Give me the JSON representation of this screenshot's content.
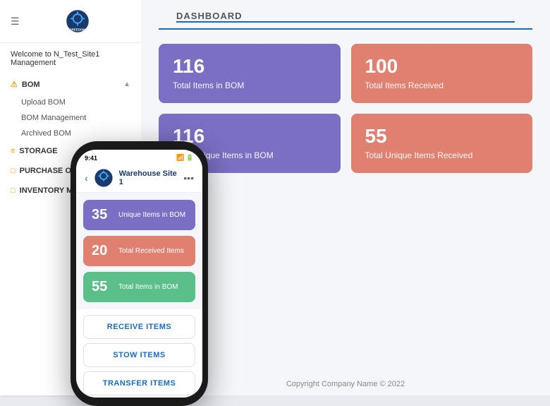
{
  "sidebar": {
    "hamburger": "☰",
    "logo_alt": "Freedom Robotics",
    "welcome_text": "Welcome to N_Test_Site1 Management",
    "nav_items": [
      {
        "id": "bom",
        "icon": "⚠",
        "label": "BOM",
        "expanded": true,
        "sub_items": [
          "Upload BOM",
          "BOM Management",
          "Archived BOM"
        ]
      },
      {
        "id": "storage",
        "icon": "≡",
        "label": "STORAGE",
        "expanded": false,
        "sub_items": []
      },
      {
        "id": "purchase-order",
        "icon": "□",
        "label": "PURCHASE ORDER DATA",
        "expanded": false,
        "sub_items": []
      },
      {
        "id": "inventory",
        "icon": "□",
        "label": "INVENTORY MANAGEMENT",
        "expanded": false,
        "sub_items": []
      }
    ]
  },
  "dashboard": {
    "title": "DASHBOARD",
    "cards": [
      {
        "id": "total-bom",
        "value": "116",
        "label": "Total Items in BOM",
        "color": "purple"
      },
      {
        "id": "total-received",
        "value": "100",
        "label": "Total Items Received",
        "color": "salmon"
      },
      {
        "id": "unique-bom",
        "value": "116",
        "label": "Total Unique Items in BOM",
        "color": "purple"
      },
      {
        "id": "unique-received",
        "value": "55",
        "label": "Total Unique Items Received",
        "color": "salmon"
      }
    ],
    "footer": "Copyright Company Name © 2022"
  },
  "phone": {
    "time": "9:41",
    "site_name": "Warehouse Site 1",
    "more_icon": "•••",
    "stats": [
      {
        "num": "35",
        "label": "Unique Items in BOM",
        "color": "purple"
      },
      {
        "num": "20",
        "label": "Total Received Items",
        "color": "salmon"
      },
      {
        "num": "55",
        "label": "Total Items in BOM",
        "color": "green"
      }
    ],
    "buttons": [
      {
        "id": "receive-items",
        "label": "RECEIVE ITEMS"
      },
      {
        "id": "stow-items",
        "label": "STOW ITEMS"
      },
      {
        "id": "transfer-items",
        "label": "TRANSFER ITEMS"
      }
    ]
  }
}
